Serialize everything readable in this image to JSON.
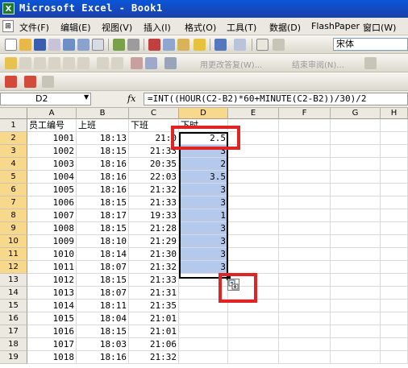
{
  "window": {
    "title": "Microsoft Excel - Book1",
    "app_icon": "excel-icon"
  },
  "menubar": {
    "items": [
      "文件(F)",
      "编辑(E)",
      "视图(V)",
      "插入(I)",
      "格式(O)",
      "工具(T)",
      "数据(D)",
      "FlashPaper",
      "窗口(W)"
    ]
  },
  "toolbar": {
    "font_name": "宋体",
    "review_reply_label": "用更改答复(W)...",
    "review_end_label": "结束审阅(N)..."
  },
  "formula_bar": {
    "name_box": "D2",
    "fx_label": "fx",
    "formula": "=INT((HOUR(C2-B2)*60+MINUTE(C2-B2))/30)/2"
  },
  "sheet": {
    "columns": [
      "A",
      "B",
      "C",
      "D",
      "E",
      "F",
      "G",
      "H"
    ],
    "selected_column": "D",
    "row_numbers": [
      "1",
      "2",
      "3",
      "4",
      "5",
      "6",
      "7",
      "8",
      "9",
      "10",
      "11",
      "12",
      "13",
      "14",
      "15",
      "16",
      "17",
      "18",
      "19"
    ],
    "header_row": [
      "员工编号",
      "上班",
      "下班",
      "下时"
    ],
    "rows": [
      [
        "1001",
        "18:13",
        "21:0",
        "2.5"
      ],
      [
        "1002",
        "18:15",
        "21:33",
        "3"
      ],
      [
        "1003",
        "18:16",
        "20:35",
        "2"
      ],
      [
        "1004",
        "18:16",
        "22:03",
        "3.5"
      ],
      [
        "1005",
        "18:16",
        "21:32",
        "3"
      ],
      [
        "1006",
        "18:15",
        "21:33",
        "3"
      ],
      [
        "1007",
        "18:17",
        "19:33",
        "1"
      ],
      [
        "1008",
        "18:15",
        "21:28",
        "3"
      ],
      [
        "1009",
        "18:10",
        "21:29",
        "3"
      ],
      [
        "1010",
        "18:14",
        "21:30",
        "3"
      ],
      [
        "1011",
        "18:07",
        "21:32",
        "3"
      ],
      [
        "1012",
        "18:15",
        "21:33",
        ""
      ],
      [
        "1013",
        "18:07",
        "21:31",
        ""
      ],
      [
        "1014",
        "18:11",
        "21:35",
        ""
      ],
      [
        "1015",
        "18:04",
        "21:01",
        ""
      ],
      [
        "1016",
        "18:15",
        "21:01",
        ""
      ],
      [
        "1017",
        "18:03",
        "21:06",
        ""
      ],
      [
        "1018",
        "18:16",
        "21:32",
        ""
      ]
    ],
    "active_cell": "D2",
    "selected_range": "D2:D12"
  },
  "colors": {
    "highlight": "#e02424",
    "selection": "#b5c9ec",
    "header_selected": "#f8d88a"
  }
}
